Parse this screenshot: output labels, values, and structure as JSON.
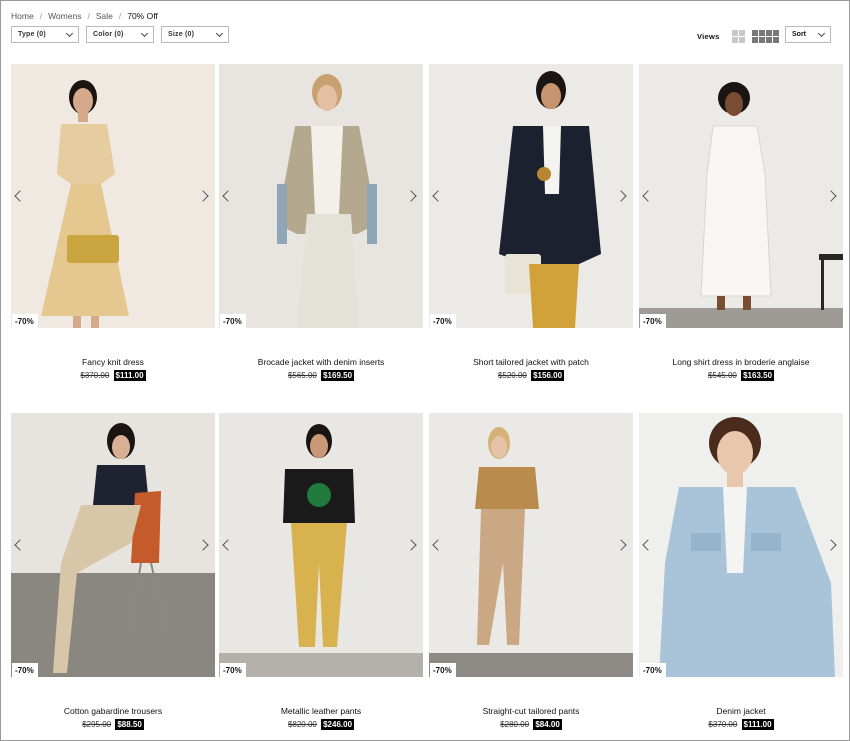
{
  "breadcrumb": {
    "home": "Home",
    "womens": "Womens",
    "sale": "Sale",
    "current": "70% Off",
    "separator": "/"
  },
  "filters": [
    {
      "label": "Type (0)"
    },
    {
      "label": "Color (0)"
    },
    {
      "label": "Size (0)"
    }
  ],
  "views": {
    "label": "Views"
  },
  "sort": {
    "label": "Sort"
  },
  "products": [
    {
      "name": "Fancy knit dress",
      "old_price": "$370.00",
      "new_price": "$111.00",
      "badge": "-70%"
    },
    {
      "name": "Brocade jacket with denim inserts",
      "old_price": "$565.00",
      "new_price": "$169.50",
      "badge": "-70%"
    },
    {
      "name": "Short tailored jacket with patch",
      "old_price": "$520.00",
      "new_price": "$156.00",
      "badge": "-70%"
    },
    {
      "name": "Long shirt dress in broderie anglaise",
      "old_price": "$545.00",
      "new_price": "$163.50",
      "badge": "-70%"
    },
    {
      "name": "Cotton gabardine trousers",
      "old_price": "$295.00",
      "new_price": "$88.50",
      "badge": "-70%"
    },
    {
      "name": "Metallic leather pants",
      "old_price": "$820.00",
      "new_price": "$246.00",
      "badge": "-70%"
    },
    {
      "name": "Straight-cut tailored pants",
      "old_price": "$280.00",
      "new_price": "$84.00",
      "badge": "-70%"
    },
    {
      "name": "Denim jacket",
      "old_price": "$370.00",
      "new_price": "$111.00",
      "badge": "-70%"
    }
  ]
}
